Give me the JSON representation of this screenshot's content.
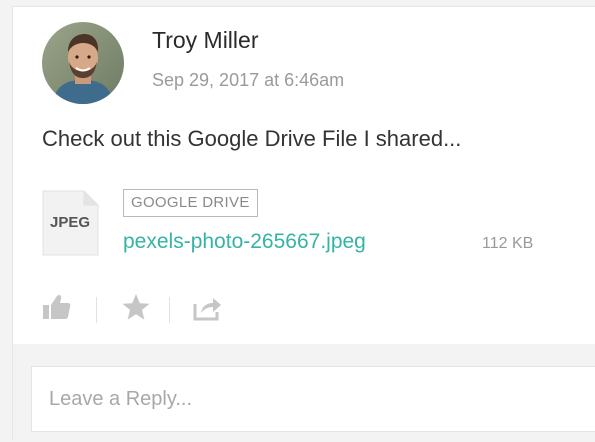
{
  "post": {
    "author": "Troy Miller",
    "timestamp": "Sep 29, 2017 at 6:46am",
    "message": "Check out this Google Drive File I shared..."
  },
  "attachment": {
    "type_label": "JPEG",
    "source": "GOOGLE DRIVE",
    "file_name": "pexels-photo-265667.jpeg",
    "file_size": "112 KB"
  },
  "actions": [
    {
      "name": "like",
      "icon": "thumbs-up-icon"
    },
    {
      "name": "favorite",
      "icon": "star-icon"
    },
    {
      "name": "share",
      "icon": "share-icon"
    }
  ],
  "reply": {
    "placeholder": "Leave a Reply..."
  },
  "colors": {
    "link": "#35b4a3",
    "icon": "#c6c6c6",
    "muted": "#9a9a9a"
  }
}
